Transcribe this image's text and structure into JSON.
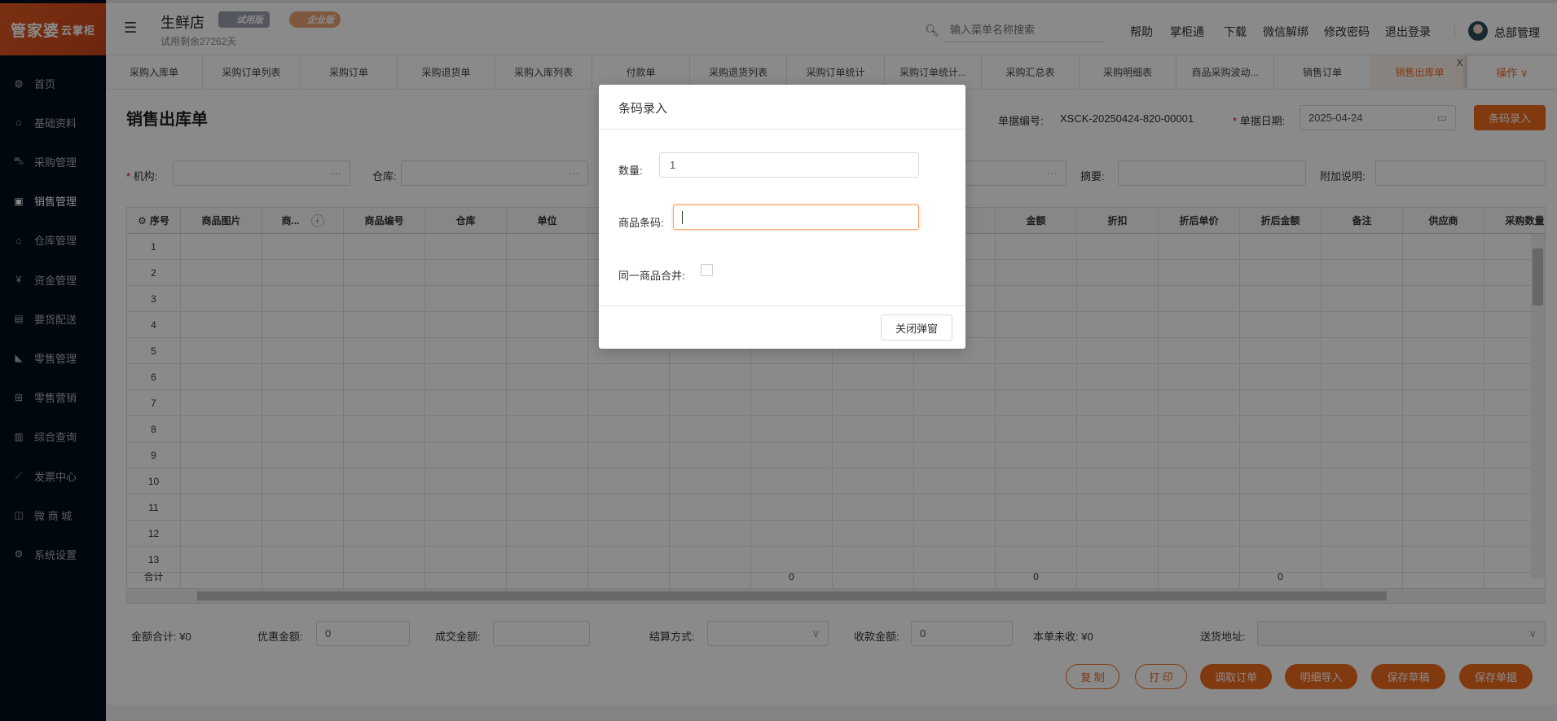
{
  "app": {
    "logo": "管家婆",
    "logo_sub": "云掌柜",
    "store_name": "生鲜店",
    "trial_badge": "试用版",
    "enterprise_badge": "企业版",
    "trial_remaining": "试用剩余27262天"
  },
  "header": {
    "search_placeholder": "输入菜单名称搜索",
    "links": [
      "帮助",
      "掌柜通",
      "下载",
      "微信解绑",
      "修改密码",
      "退出登录"
    ],
    "user": "总部管理"
  },
  "sidebar": {
    "items": [
      {
        "label": "首页",
        "icon": "globe-icon"
      },
      {
        "label": "基础资料",
        "icon": "home-icon"
      },
      {
        "label": "采购管理",
        "icon": "cart-icon"
      },
      {
        "label": "销售管理",
        "icon": "calendar-check-icon",
        "active": true
      },
      {
        "label": "仓库管理",
        "icon": "bank-icon"
      },
      {
        "label": "资金管理",
        "icon": "yen-icon"
      },
      {
        "label": "要货配送",
        "icon": "list-icon"
      },
      {
        "label": "零售管理",
        "icon": "area-chart-icon"
      },
      {
        "label": "零售营销",
        "icon": "gift-icon"
      },
      {
        "label": "综合查询",
        "icon": "bar-chart-icon"
      },
      {
        "label": "发票中心",
        "icon": "line-chart-icon"
      },
      {
        "label": "微 商 城",
        "icon": "bag-icon"
      },
      {
        "label": "系统设置",
        "icon": "gear-icon"
      }
    ]
  },
  "tabs": [
    "采购入库单",
    "采购订单列表",
    "采购订单",
    "采购退货单",
    "采购入库列表",
    "付款单",
    "采购退货列表",
    "采购订单统计",
    "采购订单统计...",
    "采购汇总表",
    "采购明细表",
    "商品采购波动...",
    "销售订单",
    "销售出库单"
  ],
  "active_tab": "销售出库单",
  "tab_ops": "操作 ∨",
  "page": {
    "title": "销售出库单",
    "doc_no_label": "单据编号:",
    "doc_no": "XSCK-20250424-820-00001",
    "date_label": "单据日期:",
    "date": "2025-04-24",
    "barcode_button": "条码录入"
  },
  "form": {
    "org_label": "机构:",
    "warehouse_label": "仓库:",
    "summary_label": "摘要:",
    "extra_label": "附加说明:"
  },
  "table": {
    "headers": [
      "序号",
      "商品图片",
      "商...",
      "商品编号",
      "仓库",
      "单位",
      "",
      "",
      "",
      "",
      "",
      "金额",
      "折扣",
      "折后单价",
      "折后金额",
      "备注",
      "供应商",
      "采购数量"
    ],
    "rows": [
      "1",
      "2",
      "3",
      "4",
      "5",
      "6",
      "7",
      "8",
      "9",
      "10",
      "11",
      "12",
      "13"
    ],
    "total_label": "合计",
    "totals": {
      "8": "0",
      "11": "0",
      "14": "0"
    }
  },
  "summary": {
    "amount_total": "金额合计: ¥0",
    "discount_label": "优惠金额:",
    "discount": "0",
    "deal_label": "成交金额:",
    "deal": "",
    "settle_label": "结算方式:",
    "received_label": "收款金额:",
    "received": "0",
    "unpaid": "本单未收: ¥0",
    "address_label": "送货地址:"
  },
  "actions": [
    "复 制",
    "打 印",
    "调取订单",
    "明细导入",
    "保存草稿",
    "保存单据"
  ],
  "modal": {
    "title": "条码录入",
    "qty_label": "数量:",
    "qty": "1",
    "barcode_label": "商品条码:",
    "barcode": "",
    "merge_label": "同一商品合并:",
    "close": "关闭弹窗"
  },
  "colors": {
    "accent": "#ee6a1f",
    "sidebar": "#020d1a"
  }
}
